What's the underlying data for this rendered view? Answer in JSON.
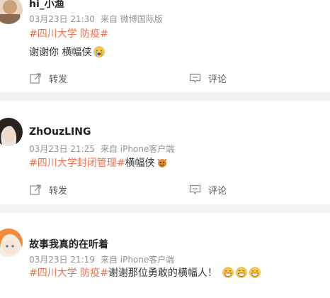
{
  "posts": [
    {
      "username": "hi_小渔",
      "date": "03月23日 21:30",
      "source": "来自 微博国际版",
      "topic": "#四川大学 防疫#",
      "text": "谢谢你 横幅侠",
      "emoji": "crying-face-icon",
      "repost_label": "转发",
      "comment_label": "评论"
    },
    {
      "username": "ZhOuzLING",
      "date": "03月23日 21:25",
      "source": "来自 iPhone客户端",
      "topic": "#四川大学封闭管理#",
      "text": "横幅侠",
      "emoji": "devil-face-icon",
      "repost_label": "转发",
      "comment_label": "评论"
    },
    {
      "username": "故事我真的在听着",
      "date": "03月23日 21:19",
      "source": "来自 iPhone客户端",
      "topic": "#四川大学 防疫#",
      "text": "谢谢那位勇敢的横幅人！",
      "emoji": "grinning-face-icon"
    }
  ],
  "colors": {
    "topic": "#eb7350",
    "meta": "#939393",
    "separator": "#f2f2f2"
  }
}
